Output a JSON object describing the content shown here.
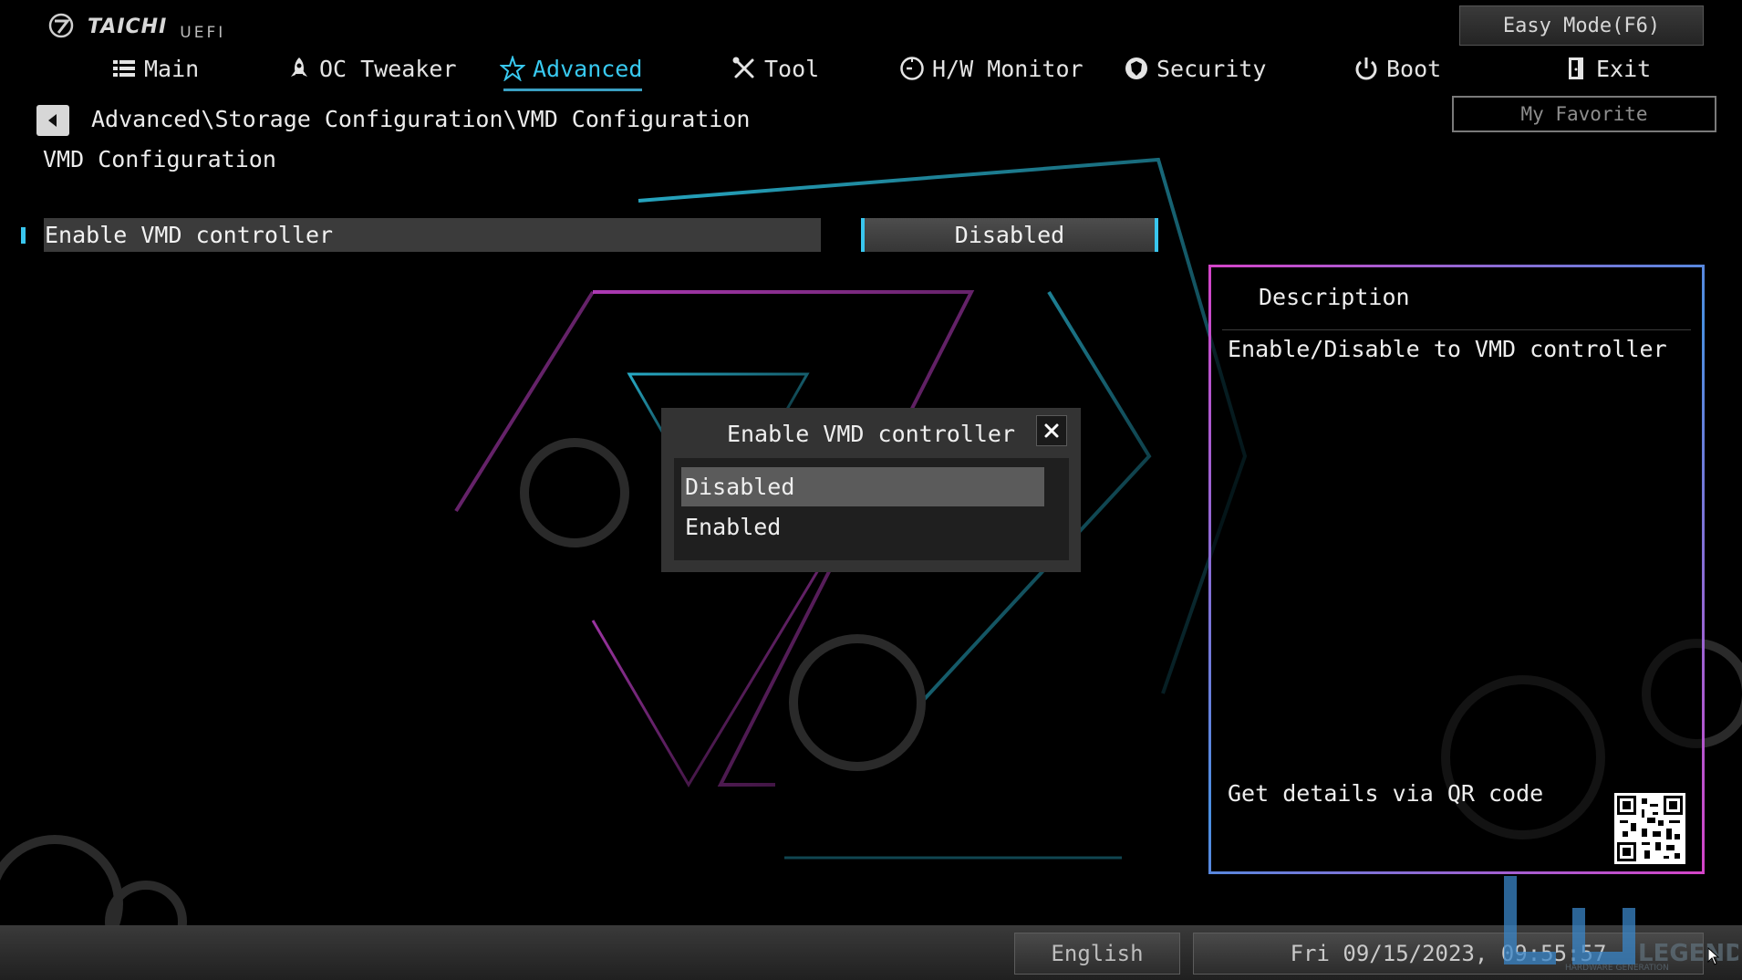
{
  "brand": {
    "name": "TAICHI",
    "sub": "UEFI"
  },
  "header": {
    "easy_mode": "Easy Mode(F6)",
    "my_favorite": "My Favorite"
  },
  "tabs": [
    {
      "label": "Main",
      "icon": "list-icon",
      "active": false
    },
    {
      "label": "OC Tweaker",
      "icon": "rocket-icon",
      "active": false
    },
    {
      "label": "Advanced",
      "icon": "star-icon",
      "active": true
    },
    {
      "label": "Tool",
      "icon": "wrench-screwdriver-icon",
      "active": false
    },
    {
      "label": "H/W Monitor",
      "icon": "gauge-icon",
      "active": false
    },
    {
      "label": "Security",
      "icon": "shield-icon",
      "active": false
    },
    {
      "label": "Boot",
      "icon": "power-icon",
      "active": false
    },
    {
      "label": "Exit",
      "icon": "door-exit-icon",
      "active": false
    }
  ],
  "breadcrumb": "Advanced\\Storage Configuration\\VMD Configuration",
  "page_title": "VMD Configuration",
  "setting": {
    "label": "Enable VMD controller",
    "value": "Disabled"
  },
  "description": {
    "title": "Description",
    "text": "Enable/Disable to VMD controller",
    "qr_label": "Get details via QR code"
  },
  "modal": {
    "title": "Enable VMD controller",
    "options": [
      "Disabled",
      "Enabled"
    ],
    "selected": "Disabled"
  },
  "footer": {
    "language": "English",
    "datetime": "Fri 09/15/2023, 09:55:57"
  },
  "watermark": {
    "text": "LEGEND",
    "sub": "HARDWARE GENERATION"
  },
  "colors": {
    "accent": "#38c9f0",
    "panel_border_pink": "#d444c8",
    "panel_border_blue": "#4a8fe0"
  }
}
